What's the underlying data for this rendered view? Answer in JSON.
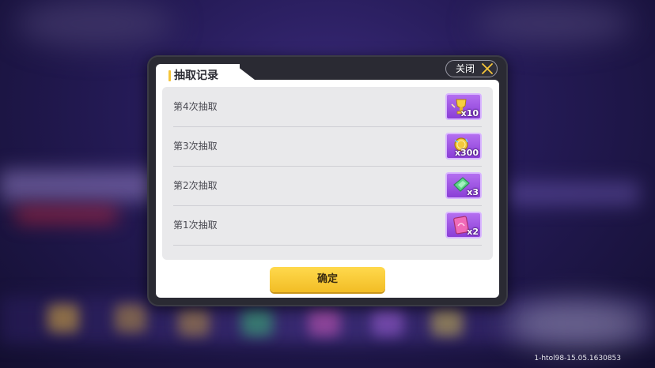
{
  "dialog": {
    "title": "抽取记录",
    "close_label": "关闭",
    "confirm_label": "确定"
  },
  "records": [
    {
      "label": "第4次抽取",
      "reward_icon": "gold-trophy-icon",
      "reward_qty": "x10"
    },
    {
      "label": "第3次抽取",
      "reward_icon": "gold-coin-icon",
      "reward_qty": "x300"
    },
    {
      "label": "第2次抽取",
      "reward_icon": "green-ticket-icon",
      "reward_qty": "x3"
    },
    {
      "label": "第1次抽取",
      "reward_icon": "pink-card-icon",
      "reward_qty": "x2"
    }
  ],
  "footer": {
    "build_id": "1-htol98-15.05.1630853"
  },
  "colors": {
    "accent": "#f5c53a",
    "tile": "#9b4fe0",
    "confirm": "#f5c73a"
  }
}
